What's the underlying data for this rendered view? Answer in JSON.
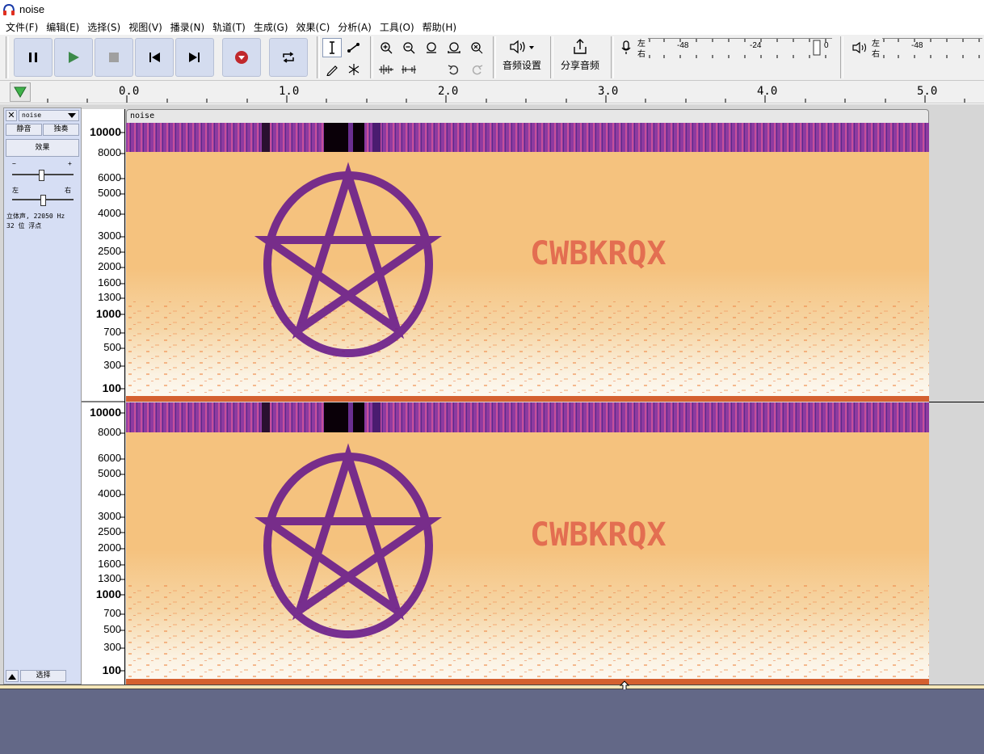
{
  "window": {
    "title": "noise"
  },
  "menu": [
    "文件(F)",
    "编辑(E)",
    "选择(S)",
    "视图(V)",
    "播录(N)",
    "轨道(T)",
    "生成(G)",
    "效果(C)",
    "分析(A)",
    "工具(O)",
    "帮助(H)"
  ],
  "toolbar": {
    "audio_setup_label": "音频设置",
    "share_audio_label": "分享音频",
    "rec_meter": {
      "left": "左",
      "right": "右",
      "ticks": [
        "-48",
        "-24",
        "0"
      ]
    },
    "play_meter": {
      "left": "左",
      "right": "右",
      "ticks": [
        "-48"
      ]
    }
  },
  "timeline": {
    "ticks": [
      "0.0",
      "1.0",
      "2.0",
      "3.0",
      "4.0",
      "5.0"
    ]
  },
  "track": {
    "name": "noise",
    "mute_label": "静音",
    "solo_label": "独奏",
    "effects_label": "效果",
    "gain_minus": "−",
    "gain_plus": "+",
    "pan_left": "左",
    "pan_right": "右",
    "info_line1": "立体声, 22050 Hz",
    "info_line2": "32 位 浮点",
    "select_label": "选择",
    "clip_name": "noise"
  },
  "freq_labels": [
    "10000",
    "8000",
    "6000",
    "5000",
    "4000",
    "3000",
    "2500",
    "2000",
    "1600",
    "1300",
    "1000",
    "700",
    "500",
    "300",
    "100"
  ],
  "spectrogram_text": "CWBKRQX",
  "colors": {
    "spec_bg": "#f5c27e",
    "spec_band": "#8e3aa0",
    "spec_mark": "#6a1d8c",
    "text_mark": "#e0604a",
    "noise_white": "#fbf7ee",
    "noise_orange": "#f09050",
    "empty_area": "#636887",
    "panel_bg": "#d6def4"
  }
}
